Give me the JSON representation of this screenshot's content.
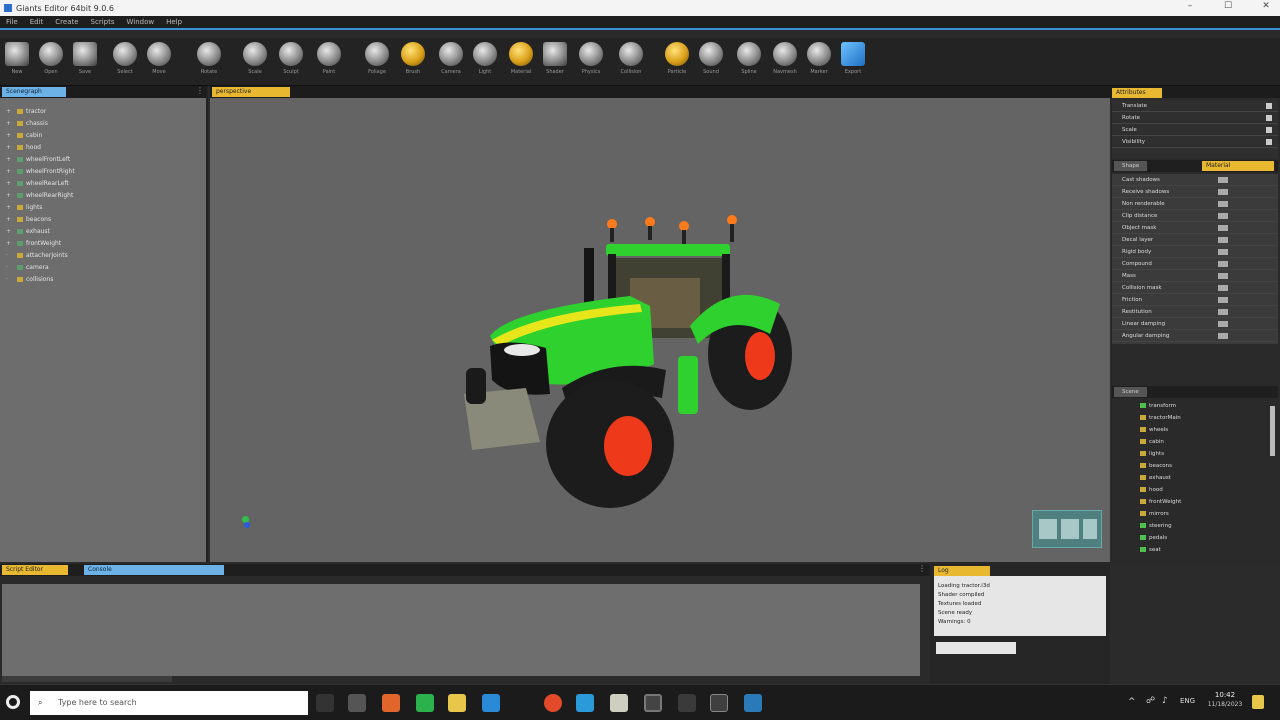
{
  "window": {
    "title": "Giants Editor 64bit 9.0.6"
  },
  "menu": [
    "File",
    "Edit",
    "Create",
    "Scripts",
    "Window",
    "Help"
  ],
  "toolbar": {
    "buttons": [
      {
        "name": "new-scene",
        "label": "New",
        "style": "sq"
      },
      {
        "name": "open-scene",
        "label": "Open",
        "style": ""
      },
      {
        "name": "save-scene",
        "label": "Save",
        "style": "sq"
      },
      {
        "name": "select-tool",
        "label": "Select",
        "style": ""
      },
      {
        "name": "move-tool",
        "label": "Move",
        "style": ""
      },
      {
        "name": "rotate-tool",
        "label": "Rotate",
        "style": ""
      },
      {
        "name": "scale-tool",
        "label": "Scale",
        "style": ""
      },
      {
        "name": "terrain-sculpt",
        "label": "Sculpt",
        "style": ""
      },
      {
        "name": "terrain-paint",
        "label": "Paint",
        "style": ""
      },
      {
        "name": "foliage-paint",
        "label": "Foliage",
        "style": ""
      },
      {
        "name": "brush-tool",
        "label": "Brush",
        "style": "gold"
      },
      {
        "name": "camera-tool",
        "label": "Camera",
        "style": ""
      },
      {
        "name": "light-tool",
        "label": "Light",
        "style": ""
      },
      {
        "name": "material-tool",
        "label": "Material",
        "style": "gold"
      },
      {
        "name": "shader-tool",
        "label": "Shader",
        "style": "sq"
      },
      {
        "name": "physics-tool",
        "label": "Physics",
        "style": ""
      },
      {
        "name": "collision-tool",
        "label": "Collision",
        "style": ""
      },
      {
        "name": "particle-tool",
        "label": "Particle",
        "style": "gold"
      },
      {
        "name": "sound-tool",
        "label": "Sound",
        "style": ""
      },
      {
        "name": "spline-tool",
        "label": "Spline",
        "style": ""
      },
      {
        "name": "navmesh-tool",
        "label": "Navmesh",
        "style": ""
      },
      {
        "name": "marker-tool",
        "label": "Marker",
        "style": ""
      },
      {
        "name": "export-tool",
        "label": "Export",
        "style": "blue"
      }
    ]
  },
  "left_panel": {
    "tab": "Scenegraph",
    "items": [
      {
        "label": "tractor",
        "icon": "folder-icon"
      },
      {
        "label": "chassis",
        "icon": "folder-icon"
      },
      {
        "label": "cabin",
        "icon": "folder-icon"
      },
      {
        "label": "hood",
        "icon": "folder-icon"
      },
      {
        "label": "wheelFrontLeft",
        "icon": "mesh-icon"
      },
      {
        "label": "wheelFrontRight",
        "icon": "mesh-icon"
      },
      {
        "label": "wheelRearLeft",
        "icon": "mesh-icon"
      },
      {
        "label": "wheelRearRight",
        "icon": "mesh-icon"
      },
      {
        "label": "lights",
        "icon": "folder-icon"
      },
      {
        "label": "beacons",
        "icon": "folder-icon"
      },
      {
        "label": "exhaust",
        "icon": "mesh-icon"
      },
      {
        "label": "frontWeight",
        "icon": "mesh-icon"
      },
      {
        "label": "attacherJoints",
        "icon": "folder-icon"
      },
      {
        "label": "camera",
        "icon": "mesh-icon"
      },
      {
        "label": "collisions",
        "icon": "folder-icon"
      }
    ]
  },
  "viewport": {
    "tab": "perspective"
  },
  "attributes_panel": {
    "tab": "Attributes",
    "rows": [
      "Translate",
      "Rotate",
      "Scale",
      "Visibility"
    ],
    "sub_tab_left": "Shape",
    "sub_tab_right": "Material",
    "props": [
      "Cast shadows",
      "Receive shadows",
      "Non renderable",
      "Clip distance",
      "Object mask",
      "Decal layer",
      "Rigid body",
      "Compound",
      "Mass",
      "Collision mask",
      "Friction",
      "Restitution",
      "Linear damping",
      "Angular damping"
    ]
  },
  "scene_panel": {
    "tab": "Scene",
    "items": [
      {
        "label": "transform",
        "icon": "g"
      },
      {
        "label": "tractorMain",
        "icon": "y"
      },
      {
        "label": "wheels",
        "icon": "y"
      },
      {
        "label": "cabin",
        "icon": "y"
      },
      {
        "label": "lights",
        "icon": "y"
      },
      {
        "label": "beacons",
        "icon": "y"
      },
      {
        "label": "exhaust",
        "icon": "y"
      },
      {
        "label": "hood",
        "icon": "y"
      },
      {
        "label": "frontWeight",
        "icon": "y"
      },
      {
        "label": "mirrors",
        "icon": "y"
      },
      {
        "label": "steering",
        "icon": "g"
      },
      {
        "label": "pedals",
        "icon": "g"
      },
      {
        "label": "seat",
        "icon": "g"
      }
    ]
  },
  "bottom_panel": {
    "tab_left": "Script Editor",
    "tab_right": "Console"
  },
  "bottom_right": {
    "tab": "Log",
    "lines": [
      "Loading tractor.i3d",
      "Shader compiled",
      "Textures loaded",
      "Scene ready",
      "Warnings: 0"
    ]
  },
  "taskbar": {
    "search_placeholder": "Type here to search",
    "clock_time": "10:42",
    "clock_date": "11/18/2023"
  }
}
